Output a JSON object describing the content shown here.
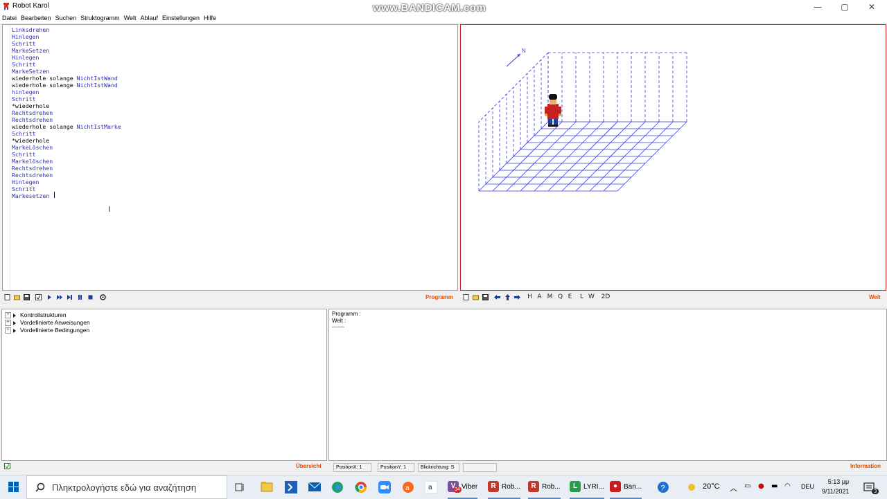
{
  "window": {
    "title": "Robot Karol",
    "minimize": "—",
    "maximize": "▢",
    "close": "✕"
  },
  "watermark": "www.BANDICAM.com",
  "menu": [
    "Datei",
    "Bearbeiten",
    "Suchen",
    "Struktogramm",
    "Welt",
    "Ablauf",
    "Einstellungen",
    "Hilfe"
  ],
  "editor": {
    "lines": [
      {
        "a": "",
        "b": "Linksdrehen"
      },
      {
        "a": "",
        "b": "Hinlegen"
      },
      {
        "a": "",
        "b": "Schritt"
      },
      {
        "a": "",
        "b": "MarkeSetzen"
      },
      {
        "a": "",
        "b": "Hinlegen"
      },
      {
        "a": "",
        "b": "Schritt"
      },
      {
        "a": "",
        "b": "MarkeSetzen"
      },
      {
        "a": "wiederhole solange ",
        "b": "NichtIstWand"
      },
      {
        "a": "wiederhole solange ",
        "b": "NichtIstWand"
      },
      {
        "a": "",
        "b": "hinlegen"
      },
      {
        "a": "",
        "b": "Schritt"
      },
      {
        "a": "*wiederhole",
        "b": ""
      },
      {
        "a": "",
        "b": "Rechtsdrehen"
      },
      {
        "a": "",
        "b": "Rechtsdrehen"
      },
      {
        "a": "wiederhole solange ",
        "b": "NichtIstMarke"
      },
      {
        "a": "",
        "b": "Schritt"
      },
      {
        "a": "*wiederhole",
        "b": ""
      },
      {
        "a": "",
        "b": "MarkeLöschen"
      },
      {
        "a": "",
        "b": "Schritt"
      },
      {
        "a": "",
        "b": "Markelöschen"
      },
      {
        "a": "",
        "b": "Rechtsdrehen"
      },
      {
        "a": "",
        "b": "Rechtsdrehen"
      },
      {
        "a": "",
        "b": "Hinlegen"
      },
      {
        "a": "",
        "b": "Schritt"
      },
      {
        "a": "",
        "b": "Markesetzen"
      }
    ],
    "toolbar_label": "Programm"
  },
  "world": {
    "compass": "N",
    "toolbar_letters": [
      "H",
      "A",
      "M",
      "Q",
      "E",
      "L",
      "W",
      "2D"
    ],
    "toolbar_label": "Welt"
  },
  "tree": {
    "items": [
      "Kontrollstrukturen",
      "Vordefinierte Anweisungen",
      "Vordefinierte Bedingungen"
    ],
    "footer_label": "Übersicht"
  },
  "info": {
    "program": "Programm :",
    "world": "Welt :",
    "rule": "———",
    "footer_label": "Information"
  },
  "status": {
    "posx": "PositionX: 1",
    "posy": "PositionY: 1",
    "direction": "Blickrichtung: S",
    "extra": ""
  },
  "taskbar": {
    "search_placeholder": "Πληκτρολογήστε εδώ για αναζήτηση",
    "apps": [
      {
        "label": "Viber",
        "color": "#7b519d",
        "glyph": "V"
      },
      {
        "label": "Rob...",
        "color": "#c0392b",
        "glyph": "R"
      },
      {
        "label": "Rob...",
        "color": "#c0392b",
        "glyph": "R"
      },
      {
        "label": "LYRI...",
        "color": "#2a9d4a",
        "glyph": "L"
      },
      {
        "label": "Ban...",
        "color": "#c81e1e",
        "glyph": "●"
      }
    ],
    "viber_badge": "34",
    "temperature": "20°C",
    "language": "DEU",
    "time": "5:13 μμ",
    "date": "9/11/2021",
    "notification_count": "3"
  },
  "colors": {
    "accent_orange": "#e05000",
    "keyword_blue": "#2b2bb8",
    "world_border": "#d02020",
    "grid_blue": "#3a3ad0"
  }
}
